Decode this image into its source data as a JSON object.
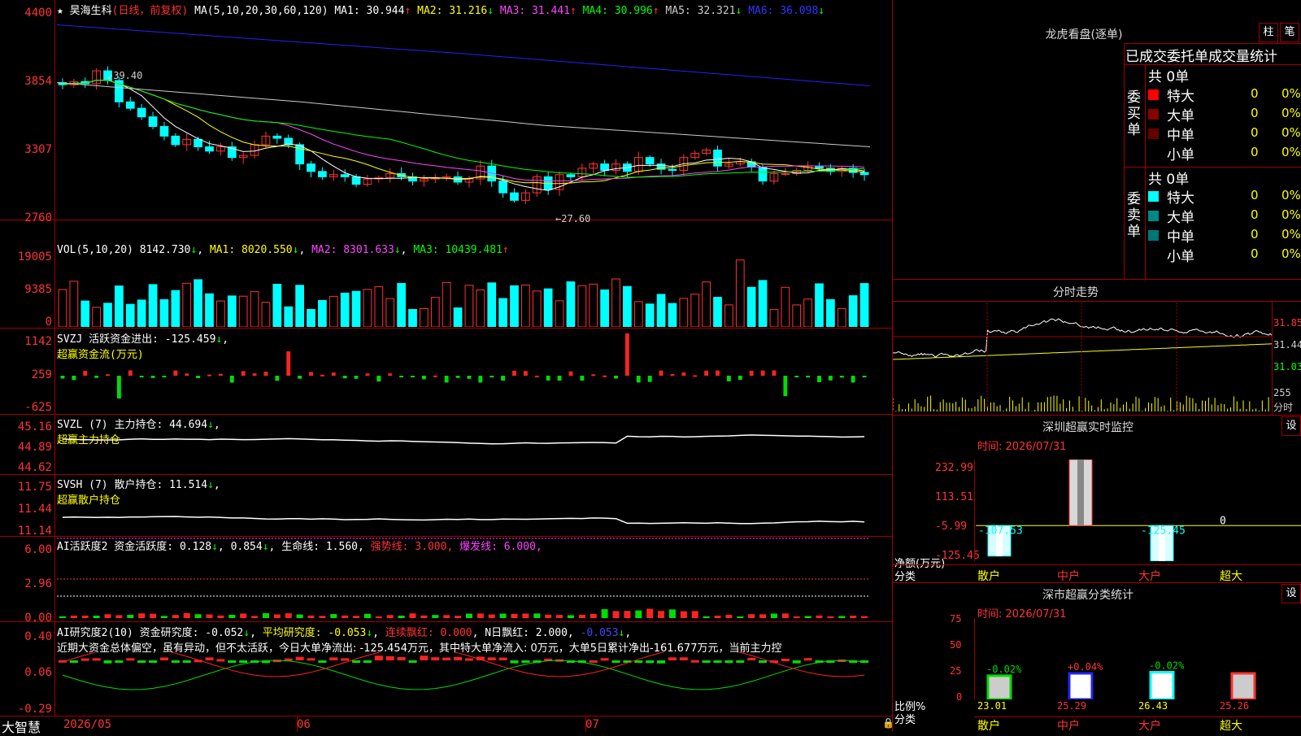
{
  "header": {
    "stock": "昊海生科",
    "period": "(日线，前复权)",
    "ma_label": "MA(5,10,20,30,60,120)",
    "ma": [
      {
        "label": "MA1:",
        "value": "30.944",
        "arrow": "↑",
        "color": "#ffffff"
      },
      {
        "label": "MA2:",
        "value": "31.216",
        "arrow": "↓",
        "color": "#ffff00"
      },
      {
        "label": "MA3:",
        "value": "31.441",
        "arrow": "↑",
        "color": "#ff44ff"
      },
      {
        "label": "MA4:",
        "value": "30.996",
        "arrow": "↑",
        "color": "#00ff00"
      },
      {
        "label": "MA5:",
        "value": "32.321",
        "arrow": "↓",
        "color": "#cccccc"
      },
      {
        "label": "MA6:",
        "value": "36.098",
        "arrow": "↓",
        "color": "#2222ff"
      }
    ]
  },
  "main_axis": [
    "4400",
    "3854",
    "3307",
    "2760"
  ],
  "annotations": {
    "high": "39.40",
    "low": "←27.60"
  },
  "vol": {
    "axis": [
      "19005",
      "9385",
      "0"
    ],
    "head": "VOL(5,10,20)",
    "value": "8142.730",
    "ma1": "MA1: 8020.550",
    "ma2": "MA2: 8301.633",
    "ma3": "MA3: 10439.481"
  },
  "svzj": {
    "axis": [
      "1142",
      "259",
      "-625"
    ],
    "line1": "SVZJ  活跃资金进出: -125.459",
    "line2": "超赢资金流(万元)"
  },
  "svzl": {
    "axis": [
      "45.16",
      "44.89",
      "44.62"
    ],
    "line1": "SVZL (7) 主力持仓: 44.694",
    "line2": "超赢主力持仓"
  },
  "svsh": {
    "axis": [
      "11.75",
      "11.44",
      "11.14"
    ],
    "line1": "SVSH (7) 散户持仓: 11.514",
    "line2": "超赢散户持仓"
  },
  "ai1": {
    "axis": [
      "6.00",
      "2.96",
      "0.00"
    ],
    "t1": "AI活跃度2 资金活跃度: 0.128",
    "t2": "0.854",
    "t3": "生命线: 1.560,",
    "t4": "强势线: 3.000,",
    "t5": "爆发线: 6.000,"
  },
  "ai2": {
    "axis": [
      "0.40",
      "0.06",
      "-0.29"
    ],
    "t1": "AI研究度2(10) 资金研究度: -0.052",
    "t2": "平均研究度: -0.053",
    "t3": "连续飘红: 0.000",
    "t4": "N日飘红: 2.000",
    "t5": "-0.053",
    "note": "近期大资金总体偏空，虽有异动，但不太活跃，今日大单净流出: -125.454万元，其中特大单净流入: 0万元，大单5日累计净出-161.677万元，当前主力控"
  },
  "bottom": {
    "brand": "大智慧",
    "d1": "2026/05",
    "d2": "06",
    "d3": "07"
  },
  "dragon": {
    "title": "龙虎看盘(逐单)",
    "btn1": "柱",
    "btn2": "笔",
    "subtitle": "已成交委托单成交量统计",
    "buy_label": "委买单",
    "sell_label": "委卖单",
    "total": "共 0单",
    "rows": [
      {
        "name": "特大",
        "val": "0",
        "pct": "0%"
      },
      {
        "name": "大单",
        "val": "0",
        "pct": "0%"
      },
      {
        "name": "中单",
        "val": "0",
        "pct": "0%"
      },
      {
        "name": "小单",
        "val": "0",
        "pct": "0%"
      }
    ]
  },
  "intraday": {
    "title": "分时走势",
    "prices": [
      "31.85",
      "31.44",
      "31.03"
    ],
    "vol": "255",
    "vol_label": "分时"
  },
  "monitor": {
    "title": "深圳超赢实时监控",
    "btn": "设",
    "time": "时间: 2026/07/31",
    "axis": [
      "232.99",
      "113.51",
      "-5.99",
      "-125.45"
    ],
    "chart_label": "净额(万元)",
    "cat_label": "分类",
    "categories": [
      "散户",
      "中户",
      "大户",
      "超大"
    ],
    "values": [
      "-107.53",
      "232.99",
      "-125.45",
      "0"
    ]
  },
  "classify": {
    "title": "深市超赢分类统计",
    "btn": "设",
    "time": "时间: 2026/07/31",
    "axis": [
      "75",
      "50",
      "25",
      "0"
    ],
    "label1": "比例%",
    "label2": "分类",
    "categories": [
      "散户",
      "中户",
      "大户",
      "超大"
    ],
    "changes": [
      "-0.02%",
      "+0.04%",
      "-0.02%",
      ""
    ],
    "values": [
      "23.01",
      "25.29",
      "26.43",
      "25.26"
    ]
  },
  "chart_data": {
    "type": "candlestick",
    "ylim": [
      2600,
      4500
    ],
    "closes": [
      3860,
      3890,
      3870,
      3990,
      3900,
      3700,
      3640,
      3560,
      3470,
      3380,
      3300,
      3350,
      3280,
      3240,
      3280,
      3180,
      3200,
      3300,
      3380,
      3360,
      3300,
      3120,
      3050,
      3000,
      3020,
      3000,
      2930,
      2980,
      2990,
      3030,
      3000,
      2960,
      2980,
      2990,
      3000,
      2950,
      2980,
      3100,
      2960,
      2850,
      2780,
      2850,
      3000,
      2880,
      3020,
      3000,
      3080,
      3120,
      3060,
      3120,
      3050,
      3180,
      3120,
      3070,
      3060,
      3180,
      3220,
      3250,
      3100,
      3120,
      3140,
      3090,
      2960,
      3030,
      3030,
      3060,
      3100,
      3080,
      3050,
      3080,
      3040,
      3020
    ]
  }
}
